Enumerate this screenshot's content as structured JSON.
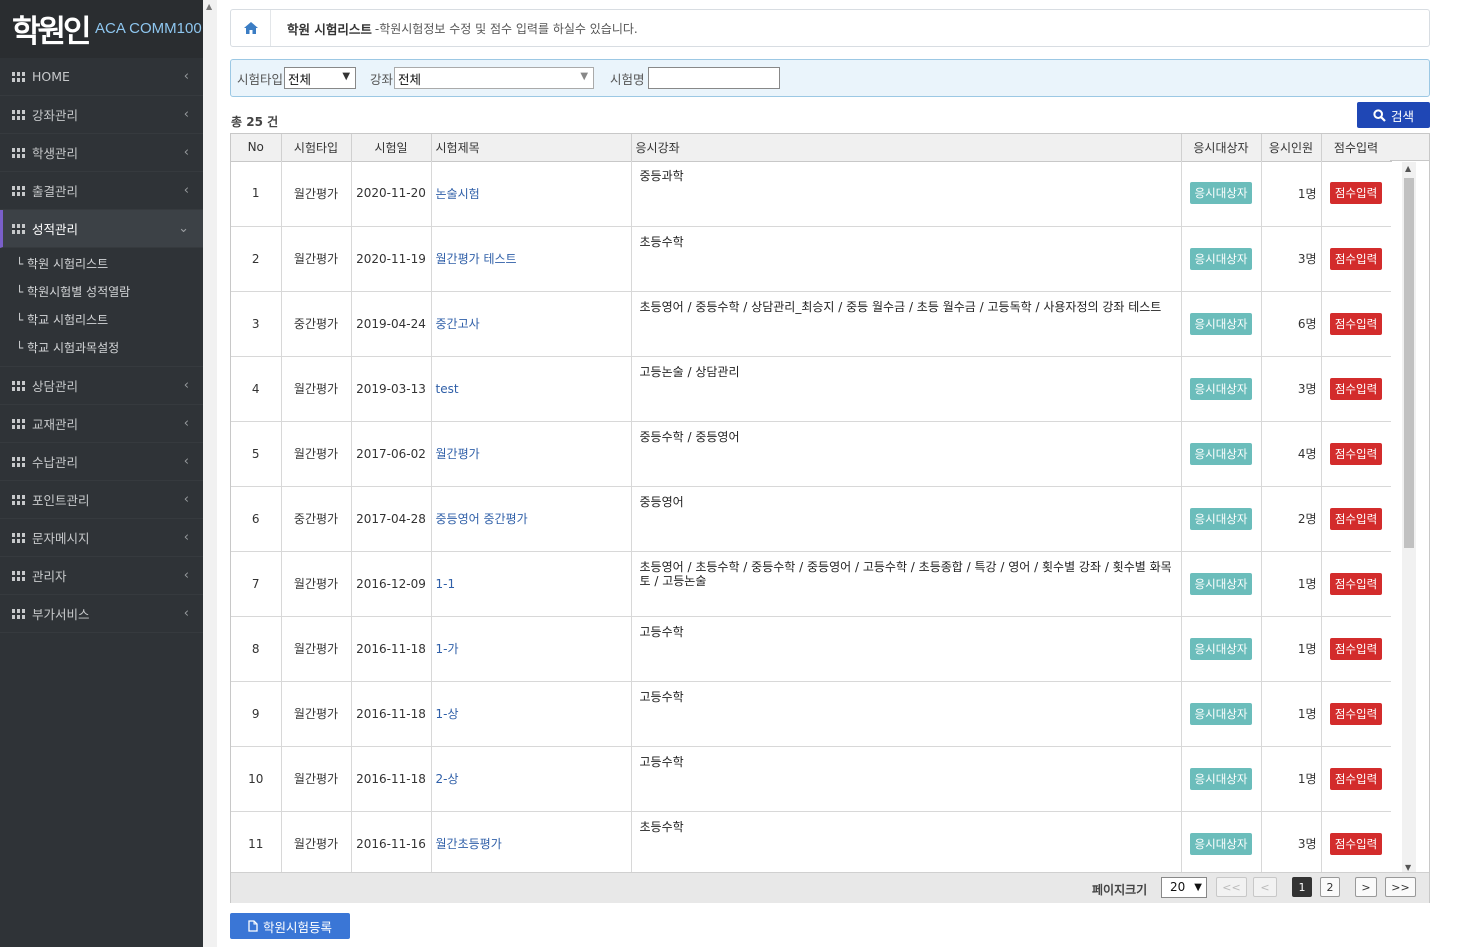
{
  "logo": {
    "mark": "학원인",
    "sub": "ACA COMM100"
  },
  "sidebar": {
    "items": [
      {
        "label": "HOME",
        "active": false
      },
      {
        "label": "강좌관리",
        "active": false
      },
      {
        "label": "학생관리",
        "active": false
      },
      {
        "label": "출결관리",
        "active": false
      },
      {
        "label": "성적관리",
        "active": true,
        "sub": [
          "학원 시험리스트",
          "학원시험별 성적열람",
          "학교 시험리스트",
          "학교 시험과목설정"
        ]
      },
      {
        "label": "상담관리",
        "active": false
      },
      {
        "label": "교재관리",
        "active": false
      },
      {
        "label": "수납관리",
        "active": false
      },
      {
        "label": "포인트관리",
        "active": false
      },
      {
        "label": "문자메시지",
        "active": false
      },
      {
        "label": "관리자",
        "active": false
      },
      {
        "label": "부가서비스",
        "active": false
      }
    ]
  },
  "breadcrumb": {
    "title": "학원 시험리스트",
    "desc": "-학원시험정보 수정 및 점수 입력를 하실수 있습니다."
  },
  "filter": {
    "type_label": "시험타입",
    "type_value": "전체",
    "course_label": "강좌",
    "course_value": "전체",
    "name_label": "시험명",
    "name_value": ""
  },
  "search_label": "검색",
  "total": "총 25 건",
  "columns": [
    "No",
    "시험타입",
    "시험일",
    "시험제목",
    "응시강좌",
    "응시대상자",
    "응시인원",
    "점수입력"
  ],
  "rows": [
    {
      "no": "1",
      "type": "월간평가",
      "date": "2020-11-20",
      "title": "논술시험",
      "course": "중등과학",
      "target": "응시대상자",
      "count": "1명",
      "score": "점수입력"
    },
    {
      "no": "2",
      "type": "월간평가",
      "date": "2020-11-19",
      "title": "월간평가 테스트",
      "course": "초등수학",
      "target": "응시대상자",
      "count": "3명",
      "score": "점수입력"
    },
    {
      "no": "3",
      "type": "중간평가",
      "date": "2019-04-24",
      "title": "중간고사",
      "course": "초등영어 / 중등수학 / 상담관리_최승지 / 중등 월수금 / 초등 월수금 / 고등독학 / 사용자정의 강좌 테스트",
      "target": "응시대상자",
      "count": "6명",
      "score": "점수입력"
    },
    {
      "no": "4",
      "type": "월간평가",
      "date": "2019-03-13",
      "title": "test",
      "course": "고등논술 / 상담관리",
      "target": "응시대상자",
      "count": "3명",
      "score": "점수입력"
    },
    {
      "no": "5",
      "type": "월간평가",
      "date": "2017-06-02",
      "title": "월간평가",
      "course": "중등수학 / 중등영어",
      "target": "응시대상자",
      "count": "4명",
      "score": "점수입력"
    },
    {
      "no": "6",
      "type": "중간평가",
      "date": "2017-04-28",
      "title": "중등영어 중간평가",
      "course": "중등영어",
      "target": "응시대상자",
      "count": "2명",
      "score": "점수입력"
    },
    {
      "no": "7",
      "type": "월간평가",
      "date": "2016-12-09",
      "title": "1-1",
      "course": "초등영어 / 초등수학 / 중등수학 / 중등영어 / 고등수학 / 초등종합 / 특강 / 영어 / 횟수별 강좌 / 횟수별 화목토 / 고등논술",
      "target": "응시대상자",
      "count": "1명",
      "score": "점수입력"
    },
    {
      "no": "8",
      "type": "월간평가",
      "date": "2016-11-18",
      "title": "1-가",
      "course": "고등수학",
      "target": "응시대상자",
      "count": "1명",
      "score": "점수입력"
    },
    {
      "no": "9",
      "type": "월간평가",
      "date": "2016-11-18",
      "title": "1-상",
      "course": "고등수학",
      "target": "응시대상자",
      "count": "1명",
      "score": "점수입력"
    },
    {
      "no": "10",
      "type": "월간평가",
      "date": "2016-11-18",
      "title": "2-상",
      "course": "고등수학",
      "target": "응시대상자",
      "count": "1명",
      "score": "점수입력"
    },
    {
      "no": "11",
      "type": "월간평가",
      "date": "2016-11-16",
      "title": "월간초등평가",
      "course": "초등수학",
      "target": "응시대상자",
      "count": "3명",
      "score": "점수입력"
    }
  ],
  "pager": {
    "size_label": "페이지크기",
    "size_value": "20",
    "first": "<<",
    "prev": "<",
    "next": ">",
    "last": ">>",
    "pages": [
      "1",
      "2"
    ]
  },
  "register_label": "학원시험등록",
  "colors": {
    "sidebar": "#2f3337",
    "search_button": "#1f47b5",
    "target_button": "#6bbdbb",
    "score_button": "#d32c2c",
    "register_button": "#3a76d6"
  }
}
